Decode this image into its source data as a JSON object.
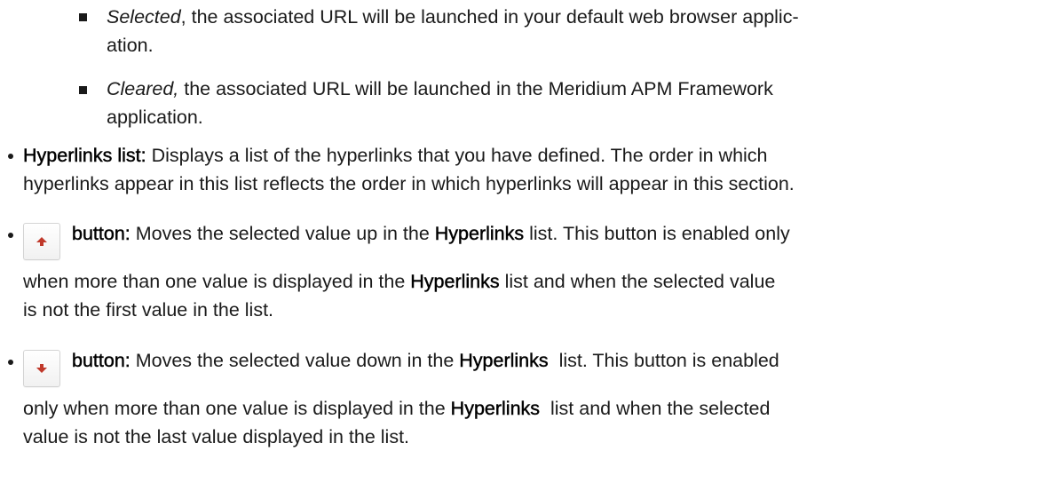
{
  "sub_items": [
    {
      "term": "Selected",
      "line1": ", the associated URL will be launched in your default web browser applic-",
      "line2": "ation."
    },
    {
      "term": "Cleared,",
      "line1": " the associated URL will be launched in the Meridium APM Framework",
      "line2": "application."
    }
  ],
  "hyperlinks_list_item": {
    "term": "Hyperlinks list:",
    "line1": " Displays a list of the hyperlinks that you have defined. The order in which",
    "line2": "hyperlinks appear in this list reflects the order in which hyperlinks will appear in this section."
  },
  "move_up_item": {
    "icon": "arrow-up-icon",
    "term": "button:",
    "line1_a": " Moves the selected value up in the ",
    "line1_term": "Hyperlinks",
    "line1_b": " list. This button is enabled only",
    "line2_a": "when more than one value is displayed in the ",
    "line2_term": "Hyperlinks",
    "line2_b": " list and when the selected value",
    "line3": "is not the first value in the list."
  },
  "move_down_item": {
    "icon": "arrow-down-icon",
    "term": "button:",
    "line1_a": " Moves the selected value down in the ",
    "line1_term": "Hyperlinks",
    "line1_b": "  list. This button is enabled",
    "line2_a": "only when more than one value is displayed in the ",
    "line2_term": "Hyperlinks",
    "line2_b": "  list and when the selected",
    "line3": "value is not the last value displayed in the list."
  },
  "colors": {
    "text": "#1a1a1a",
    "arrow": "#c0392b",
    "button_border": "#d4d4d4"
  }
}
